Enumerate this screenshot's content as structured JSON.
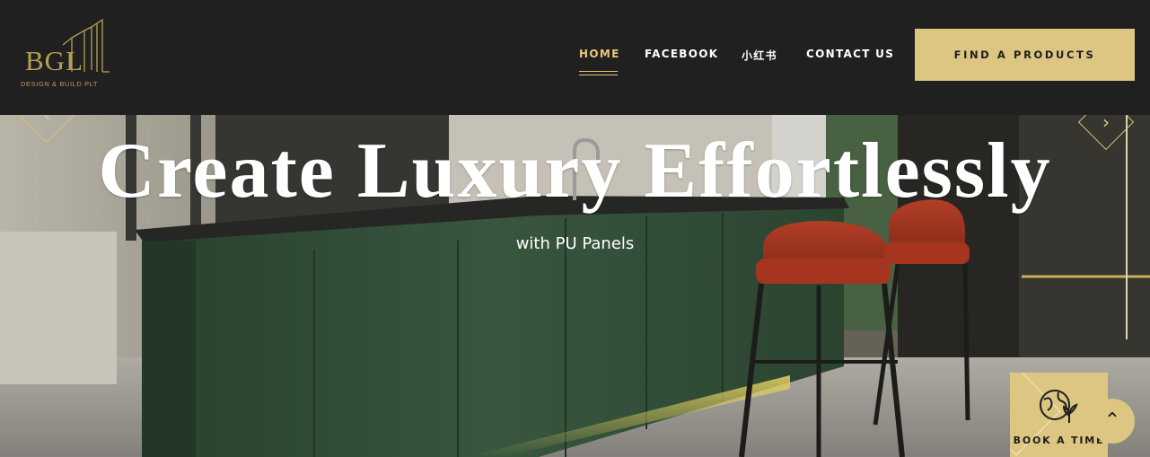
{
  "brand": {
    "logo_text": "BGL",
    "logo_subtitle": "DESIGN & BUILD PLT",
    "accent_color": "#dcc682"
  },
  "nav": {
    "items": [
      {
        "label": "HOME",
        "active": true
      },
      {
        "label": "FACEBOOK",
        "active": false
      },
      {
        "label": "小红书",
        "active": false
      },
      {
        "label": "CONTACT US",
        "active": false
      }
    ],
    "cta_label": "FIND A PRODUCTS"
  },
  "hero": {
    "title": "Create Luxury Effortlessly",
    "subtitle": "with PU Panels",
    "prev_icon": "chevron-left-icon",
    "next_icon": "chevron-right-icon"
  },
  "floating": {
    "book_label": "BOOK A TIME",
    "book_icon": "globe-plant-icon",
    "back_to_top_icon": "chevron-up-icon"
  }
}
